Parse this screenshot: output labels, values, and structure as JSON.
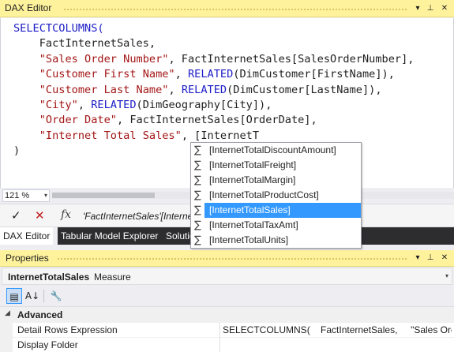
{
  "editor_window": {
    "title": "DAX Editor",
    "buttons": {
      "dropdown": "▾",
      "pin": "⊥",
      "close": "✕"
    }
  },
  "code": {
    "lines": [
      [
        {
          "t": "SELECTCOLUMNS(",
          "c": "kw"
        }
      ],
      [
        {
          "t": "    FactInternetSales,",
          "c": "plain"
        }
      ],
      [
        {
          "t": "    ",
          "c": "plain"
        },
        {
          "t": "\"Sales Order Number\"",
          "c": "str"
        },
        {
          "t": ", FactInternetSales[SalesOrderNumber],",
          "c": "plain"
        }
      ],
      [
        {
          "t": "    ",
          "c": "plain"
        },
        {
          "t": "\"Customer First Name\"",
          "c": "str"
        },
        {
          "t": ", ",
          "c": "plain"
        },
        {
          "t": "RELATED",
          "c": "kw"
        },
        {
          "t": "(DimCustomer[FirstName]),",
          "c": "plain"
        }
      ],
      [
        {
          "t": "    ",
          "c": "plain"
        },
        {
          "t": "\"Customer Last Name\"",
          "c": "str"
        },
        {
          "t": ", ",
          "c": "plain"
        },
        {
          "t": "RELATED",
          "c": "kw"
        },
        {
          "t": "(DimCustomer[LastName]),",
          "c": "plain"
        }
      ],
      [
        {
          "t": "    ",
          "c": "plain"
        },
        {
          "t": "\"City\"",
          "c": "str"
        },
        {
          "t": ", ",
          "c": "plain"
        },
        {
          "t": "RELATED",
          "c": "kw"
        },
        {
          "t": "(DimGeography[City]),",
          "c": "plain"
        }
      ],
      [
        {
          "t": "    ",
          "c": "plain"
        },
        {
          "t": "\"Order Date\"",
          "c": "str"
        },
        {
          "t": ", FactInternetSales[OrderDate],",
          "c": "plain"
        }
      ],
      [
        {
          "t": "    ",
          "c": "plain"
        },
        {
          "t": "\"Internet Total Sales\"",
          "c": "str"
        },
        {
          "t": ", [InternetT",
          "c": "plain"
        }
      ],
      [
        {
          "t": ")",
          "c": "plain"
        }
      ]
    ]
  },
  "autocomplete": {
    "icon": "sigma-icon",
    "items": [
      {
        "label": "[InternetTotalDiscountAmount]",
        "selected": false
      },
      {
        "label": "[InternetTotalFreight]",
        "selected": false
      },
      {
        "label": "[InternetTotalMargin]",
        "selected": false
      },
      {
        "label": "[InternetTotalProductCost]",
        "selected": false
      },
      {
        "label": "[InternetTotalSales]",
        "selected": true
      },
      {
        "label": "[InternetTotalTaxAmt]",
        "selected": false
      },
      {
        "label": "[InternetTotalUnits]",
        "selected": false
      }
    ]
  },
  "zoom": {
    "value": "121 %",
    "arrow": "▾"
  },
  "formula_bar": {
    "confirm": "✓",
    "cancel": "✕",
    "fx": "fx",
    "text": "'FactInternetSales'[InternetTotalSales]"
  },
  "tabs": [
    {
      "label": "DAX Editor",
      "active": true
    },
    {
      "label": "Tabular Model Explorer",
      "active": false
    },
    {
      "label": "Solution Explorer",
      "active": false
    }
  ],
  "properties": {
    "title": "Properties",
    "buttons": {
      "dropdown": "▾",
      "pin": "⊥",
      "close": "✕"
    },
    "object_name": "InternetTotalSales",
    "object_kind": "Measure",
    "toolbar": {
      "categorized": "▤",
      "alphabetical": "A↓",
      "pages": "🔧"
    },
    "category": {
      "toggle": "◢",
      "label": "Advanced"
    },
    "rows": [
      {
        "name": "Detail Rows Expression",
        "value": "SELECTCOLUMNS(    FactInternetSales,     \"Sales Order"
      },
      {
        "name": "Display Folder",
        "value": ""
      }
    ]
  }
}
